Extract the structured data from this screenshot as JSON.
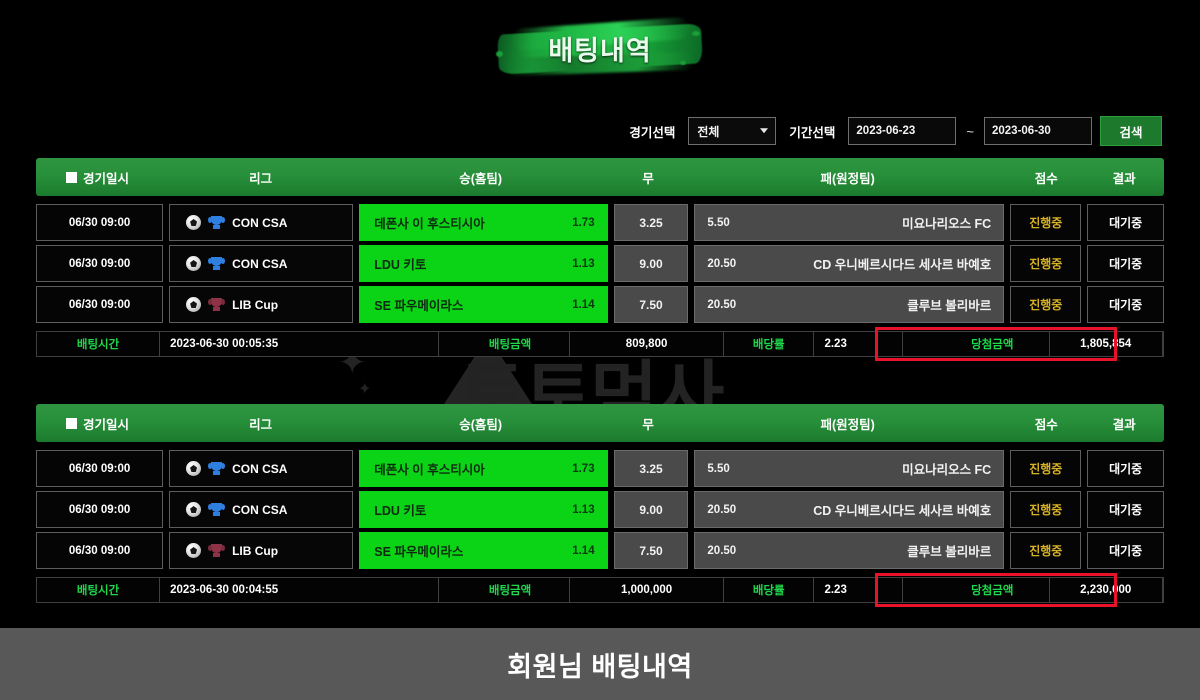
{
  "page": {
    "title": "배팅내역",
    "footer_caption": "회원님 배팅내역",
    "watermark_text": "토토먹사",
    "accent_green": "#0bd315",
    "header_green": "#27903a",
    "highlight_red": "#e8132a",
    "status_gold": "#d8b226"
  },
  "filter": {
    "match_select_label": "경기선택",
    "match_select_value": "전체",
    "period_label": "기간선택",
    "date_from": "2023-06-23",
    "date_separator": "~",
    "date_to": "2023-06-30",
    "search_button": "검색"
  },
  "table_headers": {
    "date": "경기일시",
    "league": "리그",
    "home": "승(홈팀)",
    "draw": "무",
    "away": "패(원정팀)",
    "score": "점수",
    "result": "결과"
  },
  "summary_labels": {
    "time": "배팅시간",
    "amount": "배팅금액",
    "odds": "배당률",
    "win": "당첨금액"
  },
  "bets": [
    {
      "matches": [
        {
          "date": "06/30 09:00",
          "league": "CON CSA",
          "league_icon": "soccer-ball-icon",
          "cup_icon": "trophy-blue-icon",
          "home_team": "데폰사 이 후스티시아",
          "home_odd": "1.73",
          "draw_odd": "3.25",
          "away_odd": "5.50",
          "away_team": "미요나리오스 FC",
          "score": "진행중",
          "result": "대기중"
        },
        {
          "date": "06/30 09:00",
          "league": "CON CSA",
          "league_icon": "soccer-ball-icon",
          "cup_icon": "trophy-blue-icon",
          "home_team": "LDU 키토",
          "home_odd": "1.13",
          "draw_odd": "9.00",
          "away_odd": "20.50",
          "away_team": "CD 우니베르시다드 세사르 바예호",
          "score": "진행중",
          "result": "대기중"
        },
        {
          "date": "06/30 09:00",
          "league": "LIB Cup",
          "league_icon": "soccer-ball-icon",
          "cup_icon": "trophy-dark-icon",
          "home_team": "SE 파우메이라스",
          "home_odd": "1.14",
          "draw_odd": "7.50",
          "away_odd": "20.50",
          "away_team": "클루브 볼리바르",
          "score": "진행중",
          "result": "대기중"
        }
      ],
      "summary": {
        "time": "2023-06-30 00:05:35",
        "amount": "809,800",
        "odds": "2.23",
        "win": "1,805,854"
      }
    },
    {
      "matches": [
        {
          "date": "06/30 09:00",
          "league": "CON CSA",
          "league_icon": "soccer-ball-icon",
          "cup_icon": "trophy-blue-icon",
          "home_team": "데폰사 이 후스티시아",
          "home_odd": "1.73",
          "draw_odd": "3.25",
          "away_odd": "5.50",
          "away_team": "미요나리오스 FC",
          "score": "진행중",
          "result": "대기중"
        },
        {
          "date": "06/30 09:00",
          "league": "CON CSA",
          "league_icon": "soccer-ball-icon",
          "cup_icon": "trophy-blue-icon",
          "home_team": "LDU 키토",
          "home_odd": "1.13",
          "draw_odd": "9.00",
          "away_odd": "20.50",
          "away_team": "CD 우니베르시다드 세사르 바예호",
          "score": "진행중",
          "result": "대기중"
        },
        {
          "date": "06/30 09:00",
          "league": "LIB Cup",
          "league_icon": "soccer-ball-icon",
          "cup_icon": "trophy-dark-icon",
          "home_team": "SE 파우메이라스",
          "home_odd": "1.14",
          "draw_odd": "7.50",
          "away_odd": "20.50",
          "away_team": "클루브 볼리바르",
          "score": "진행중",
          "result": "대기중"
        }
      ],
      "summary": {
        "time": "2023-06-30 00:04:55",
        "amount": "1,000,000",
        "odds": "2.23",
        "win": "2,230,000"
      }
    }
  ]
}
